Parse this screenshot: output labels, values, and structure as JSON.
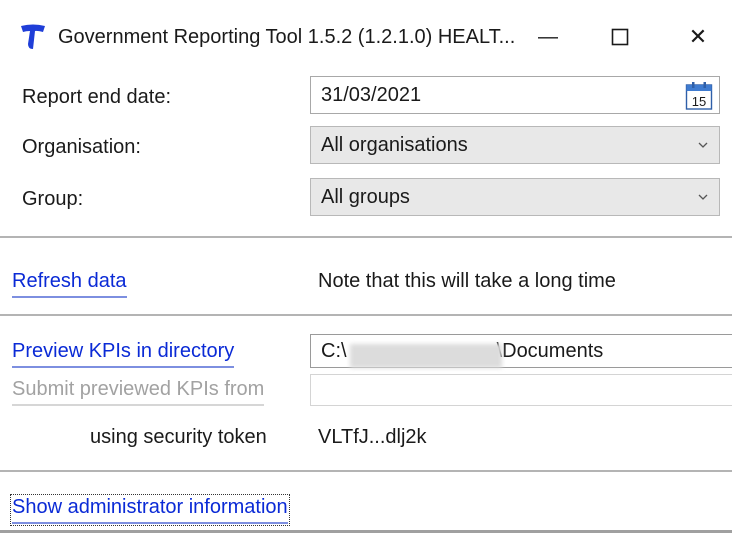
{
  "window": {
    "title": "Government Reporting Tool 1.5.2 (1.2.1.0) HEALT...",
    "minimize_glyph": "—",
    "close_glyph": "✕"
  },
  "form": {
    "report_end_date": {
      "label": "Report end date:",
      "value": "31/03/2021",
      "calendar_day": "15"
    },
    "organisation": {
      "label": "Organisation:",
      "value": "All organisations"
    },
    "group": {
      "label": "Group:",
      "value": "All groups"
    }
  },
  "refresh": {
    "link": "Refresh data",
    "note": "Note that this will take a long time"
  },
  "preview": {
    "link": "Preview KPIs in directory",
    "path_prefix": "C:\\",
    "path_suffix": "\\Documents"
  },
  "submit": {
    "link": "Submit previewed KPIs from",
    "path": ""
  },
  "security": {
    "label": "using security token",
    "token": "VLTfJ...dlj2k"
  },
  "admin": {
    "link": "Show administrator information"
  },
  "colors": {
    "link": "#0a2ad6",
    "disabled": "#a2a2a2",
    "brand": "#1f3ed8"
  }
}
